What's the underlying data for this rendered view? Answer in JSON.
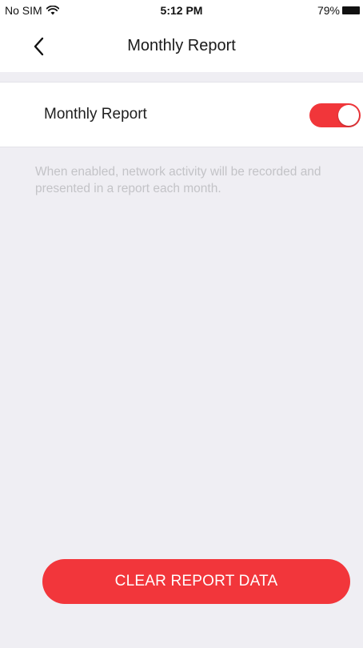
{
  "status_bar": {
    "carrier": "No SIM",
    "time": "5:12 PM",
    "battery": "79%"
  },
  "nav": {
    "title": "Monthly Report",
    "back_icon": "chevron-left-icon"
  },
  "setting": {
    "label": "Monthly Report",
    "enabled": true,
    "toggle_color": "#f1363a"
  },
  "description": "When enabled, network activity will be recorded and presented in a report each month.",
  "actions": {
    "clear_label": "CLEAR REPORT DATA",
    "clear_color": "#f2363b"
  },
  "colors": {
    "background": "#efeef3",
    "description_text": "#c3c3c7"
  }
}
